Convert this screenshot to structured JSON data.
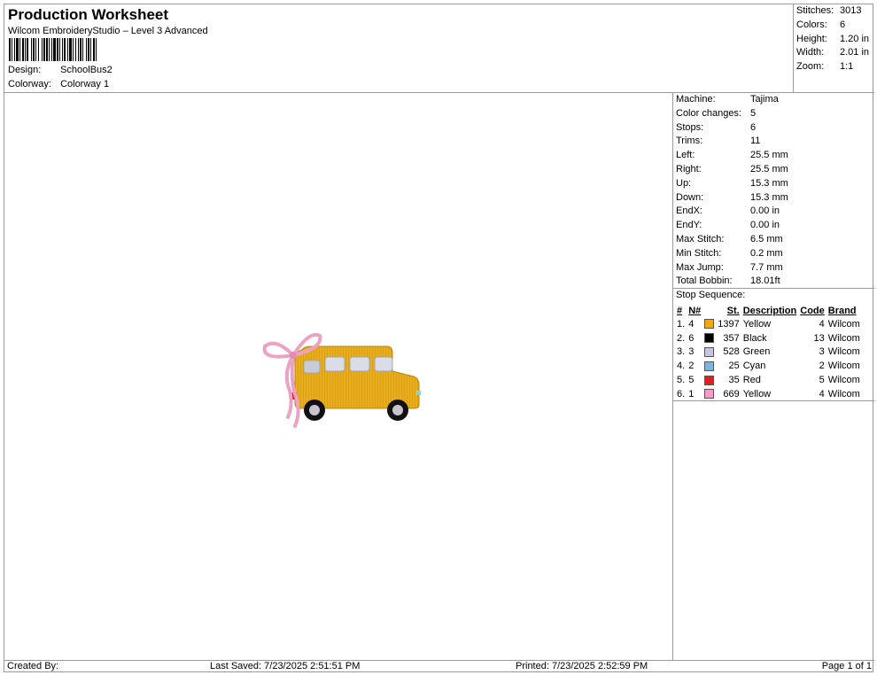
{
  "header": {
    "title": "Production Worksheet",
    "subtitle": "Wilcom EmbroideryStudio – Level 3 Advanced",
    "design_label": "Design:",
    "design_value": "SchoolBus2",
    "colorway_label": "Colorway:",
    "colorway_value": "Colorway 1"
  },
  "summary": [
    {
      "label": "Stitches:",
      "value": "3013"
    },
    {
      "label": "Colors:",
      "value": "6"
    },
    {
      "label": "Height:",
      "value": "1.20 in"
    },
    {
      "label": "Width:",
      "value": "2.01 in"
    },
    {
      "label": "Zoom:",
      "value": "1:1"
    }
  ],
  "machine_info": [
    {
      "label": "Machine:",
      "value": "Tajima"
    },
    {
      "label": "Color changes:",
      "value": "5"
    },
    {
      "label": "Stops:",
      "value": "6"
    },
    {
      "label": "Trims:",
      "value": "11"
    },
    {
      "label": "Left:",
      "value": "25.5 mm"
    },
    {
      "label": "Right:",
      "value": "25.5 mm"
    },
    {
      "label": "Up:",
      "value": "15.3 mm"
    },
    {
      "label": "Down:",
      "value": "15.3 mm"
    },
    {
      "label": "EndX:",
      "value": "0.00 in"
    },
    {
      "label": "EndY:",
      "value": "0.00 in"
    },
    {
      "label": "Max Stitch:",
      "value": "6.5 mm"
    },
    {
      "label": "Min Stitch:",
      "value": "0.2 mm"
    },
    {
      "label": "Max Jump:",
      "value": "7.7 mm"
    },
    {
      "label": "Total Bobbin:",
      "value": "18.01ft"
    }
  ],
  "stop_sequence": {
    "title": "Stop Sequence:",
    "columns": [
      "#",
      "N#",
      "St.",
      "Description",
      "Code",
      "Brand"
    ],
    "rows": [
      {
        "idx": "1.",
        "n": "4",
        "color": "#f2a900",
        "st": "1397",
        "desc": "Yellow",
        "code": "4",
        "brand": "Wilcom"
      },
      {
        "idx": "2.",
        "n": "6",
        "color": "#000000",
        "st": "357",
        "desc": "Black",
        "code": "13",
        "brand": "Wilcom"
      },
      {
        "idx": "3.",
        "n": "3",
        "color": "#c9c3e3",
        "st": "528",
        "desc": "Green",
        "code": "3",
        "brand": "Wilcom"
      },
      {
        "idx": "4.",
        "n": "2",
        "color": "#7fb3e0",
        "st": "25",
        "desc": "Cyan",
        "code": "2",
        "brand": "Wilcom"
      },
      {
        "idx": "5.",
        "n": "5",
        "color": "#e02020",
        "st": "35",
        "desc": "Red",
        "code": "5",
        "brand": "Wilcom"
      },
      {
        "idx": "6.",
        "n": "1",
        "color": "#f0a0c8",
        "st": "669",
        "desc": "Yellow",
        "code": "4",
        "brand": "Wilcom"
      }
    ]
  },
  "footer": {
    "created_by": "Created By:",
    "last_saved": "Last Saved: 7/23/2025 2:51:51 PM",
    "printed": "Printed: 7/23/2025 2:52:59 PM",
    "page": "Page 1 of 1"
  }
}
